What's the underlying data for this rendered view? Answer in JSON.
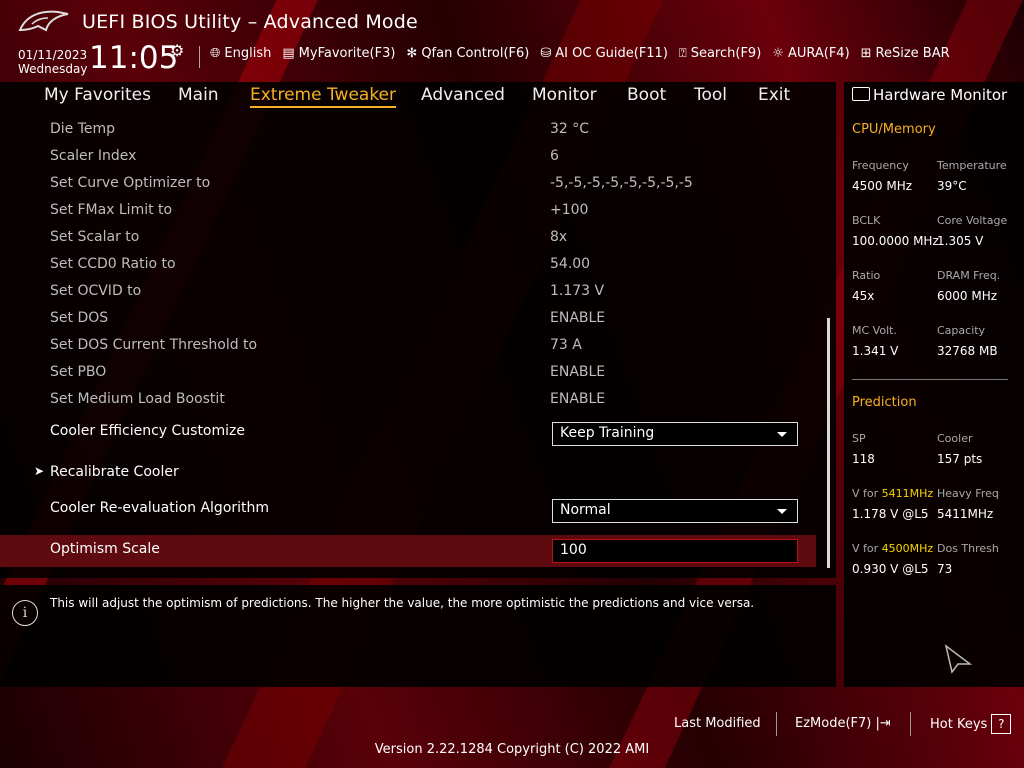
{
  "header": {
    "title": "UEFI BIOS Utility – Advanced Mode",
    "date": "01/11/2023",
    "weekday": "Wednesday",
    "time": "11:05",
    "toolbar": [
      {
        "label": "English",
        "icon": "globe-icon"
      },
      {
        "label": "MyFavorite(F3)",
        "icon": "favorite-icon"
      },
      {
        "label": "Qfan Control(F6)",
        "icon": "fan-icon"
      },
      {
        "label": "AI OC Guide(F11)",
        "icon": "chip-icon"
      },
      {
        "label": "Search(F9)",
        "icon": "search-icon"
      },
      {
        "label": "AURA(F4)",
        "icon": "aura-icon"
      },
      {
        "label": "ReSize BAR",
        "icon": "resize-bar-icon"
      }
    ]
  },
  "tabs": [
    "My Favorites",
    "Main",
    "Extreme Tweaker",
    "Advanced",
    "Monitor",
    "Boot",
    "Tool",
    "Exit"
  ],
  "active_tab": "Extreme Tweaker",
  "settings": [
    {
      "label": "Die Temp",
      "value": "32 °C"
    },
    {
      "label": "Scaler Index",
      "value": "6"
    },
    {
      "label": "Set Curve Optimizer to",
      "value": "-5,-5,-5,-5,-5,-5,-5,-5"
    },
    {
      "label": "Set FMax Limit to",
      "value": "+100"
    },
    {
      "label": "Set Scalar to",
      "value": "8x"
    },
    {
      "label": "Set CCD0 Ratio to",
      "value": "54.00"
    },
    {
      "label": "Set OCVID to",
      "value": "1.173 V"
    },
    {
      "label": "Set DOS",
      "value": "ENABLE"
    },
    {
      "label": "Set DOS Current Threshold to",
      "value": "73 A"
    },
    {
      "label": "Set PBO",
      "value": "ENABLE"
    },
    {
      "label": "Set Medium Load Boostit",
      "value": "ENABLE"
    }
  ],
  "cooler_efficiency": {
    "label": "Cooler Efficiency Customize",
    "value": "Keep Training"
  },
  "recalibrate": {
    "label": "Recalibrate Cooler"
  },
  "reeval": {
    "label": "Cooler Re-evaluation Algorithm",
    "value": "Normal"
  },
  "optimism": {
    "label": "Optimism Scale",
    "value": "100"
  },
  "help_text": "This will adjust the optimism of predictions. The higher the value, the more optimistic the predictions and vice versa.",
  "hardware_monitor": {
    "title": "Hardware Monitor",
    "cpu_memory": {
      "heading": "CPU/Memory",
      "items": [
        {
          "k": "Frequency",
          "v": "4500 MHz"
        },
        {
          "k": "Temperature",
          "v": "39°C"
        },
        {
          "k": "BCLK",
          "v": "100.0000 MHz"
        },
        {
          "k": "Core Voltage",
          "v": "1.305 V"
        },
        {
          "k": "Ratio",
          "v": "45x"
        },
        {
          "k": "DRAM Freq.",
          "v": "6000 MHz"
        },
        {
          "k": "MC Volt.",
          "v": "1.341 V"
        },
        {
          "k": "Capacity",
          "v": "32768 MB"
        }
      ]
    },
    "prediction": {
      "heading": "Prediction",
      "sp_label": "SP",
      "sp_value": "118",
      "cooler_label": "Cooler",
      "cooler_value": "157 pts",
      "v1_prefix": "V for ",
      "v1_freq": "5411MHz",
      "v1_value": "1.178 V @L5",
      "heavy_label": "Heavy Freq",
      "heavy_value": "5411MHz",
      "v2_prefix": "V for ",
      "v2_freq": "4500MHz",
      "v2_value": "0.930 V @L5",
      "dos_label": "Dos Thresh",
      "dos_value": "73"
    }
  },
  "footer": {
    "last_modified": "Last Modified",
    "ezmode": "EzMode(F7)",
    "hotkeys": "Hot Keys",
    "hotkeys_key": "?",
    "version": "Version 2.22.1284 Copyright (C) 2022 AMI"
  },
  "colors": {
    "accent": "#f5b026",
    "selection": "#5e0a0e",
    "highlight": "#f5d400"
  }
}
